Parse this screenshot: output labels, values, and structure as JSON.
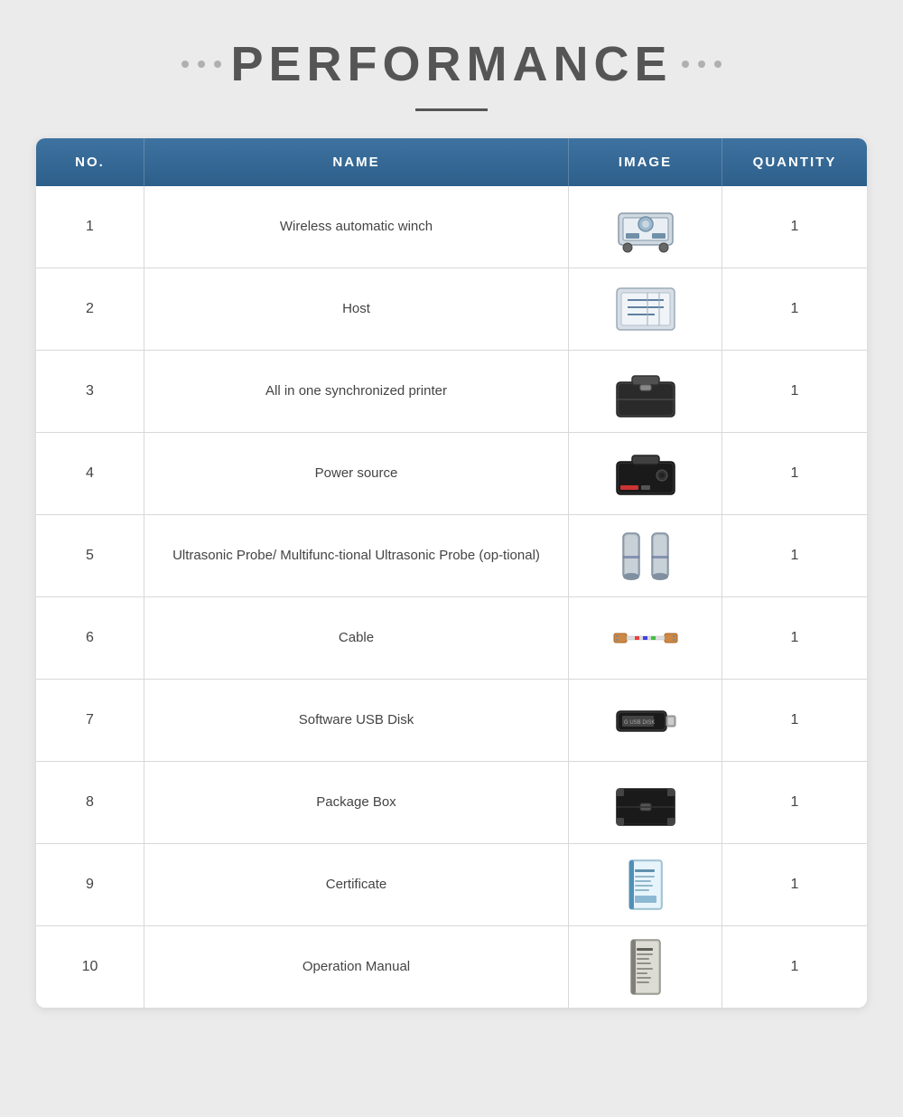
{
  "page": {
    "title": "PERFORMANCE",
    "title_underline": true
  },
  "table": {
    "headers": [
      "NO.",
      "NAME",
      "IMAGE",
      "QUANTITY"
    ],
    "rows": [
      {
        "no": "1",
        "name": "Wireless automatic winch",
        "quantity": "1",
        "image_desc": "winch"
      },
      {
        "no": "2",
        "name": "Host",
        "quantity": "1",
        "image_desc": "host"
      },
      {
        "no": "3",
        "name": "All in one synchronized printer",
        "quantity": "1",
        "image_desc": "printer"
      },
      {
        "no": "4",
        "name": "Power source",
        "quantity": "1",
        "image_desc": "power"
      },
      {
        "no": "5",
        "name": "Ultrasonic Probe/ Multifunc-tional Ultrasonic Probe (op-tional)",
        "quantity": "1",
        "image_desc": "probe"
      },
      {
        "no": "6",
        "name": "Cable",
        "quantity": "1",
        "image_desc": "cable"
      },
      {
        "no": "7",
        "name": "Software USB Disk",
        "quantity": "1",
        "image_desc": "usb"
      },
      {
        "no": "8",
        "name": "Package Box",
        "quantity": "1",
        "image_desc": "box"
      },
      {
        "no": "9",
        "name": "Certificate",
        "quantity": "1",
        "image_desc": "certificate"
      },
      {
        "no": "10",
        "name": "Operation Manual",
        "quantity": "1",
        "image_desc": "manual"
      }
    ]
  }
}
